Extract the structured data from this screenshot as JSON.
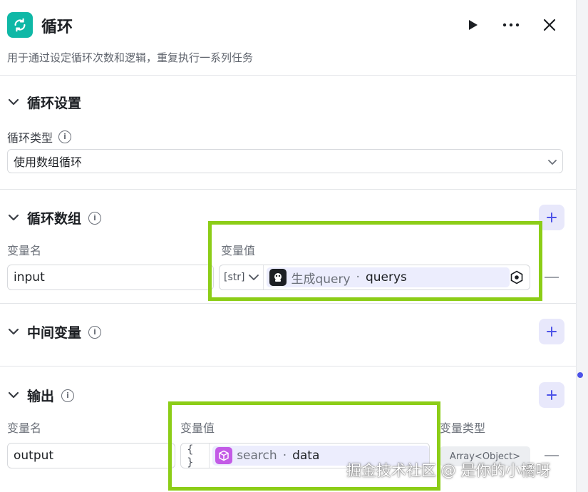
{
  "header": {
    "title": "循环",
    "description": "用于通过设定循环次数和逻辑，重复执行一系列任务",
    "icons": {
      "node": "loop-icon",
      "run": "play-icon",
      "more": "more-icon",
      "close": "close-icon"
    }
  },
  "loop_settings": {
    "section_title": "循环设置",
    "type_label": "循环类型",
    "type_value": "使用数组循环"
  },
  "loop_array": {
    "section_title": "循环数组",
    "name_header": "变量名",
    "value_header": "变量值",
    "row": {
      "name": "input",
      "type_tag": "[str]",
      "ref_node": "生成query",
      "ref_sep": "·",
      "ref_var": "querys"
    }
  },
  "intermediate": {
    "section_title": "中间变量"
  },
  "output": {
    "section_title": "输出",
    "name_header": "变量名",
    "value_header": "变量值",
    "type_header": "变量类型",
    "row": {
      "name": "output",
      "type_tag": "{ }",
      "ref_node": "search",
      "ref_sep": "·",
      "ref_var": "data",
      "var_type": "Array<Object>"
    }
  },
  "watermark": "掘金技术社区 @ 是你的小橘呀",
  "colors": {
    "accent": "#4d53e8",
    "node_icon": "#0fb8a6",
    "highlight": "#8ccd17",
    "chip_bg": "#ecedfd"
  }
}
